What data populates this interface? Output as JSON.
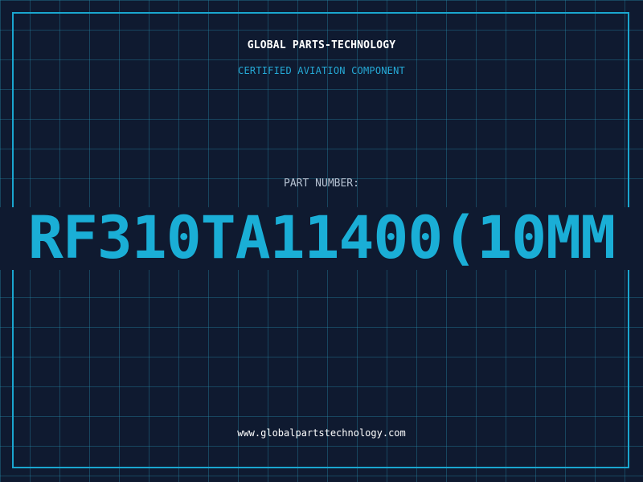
{
  "header": {
    "company": "GLOBAL PARTS-TECHNOLOGY",
    "subtitle": "CERTIFIED AVIATION COMPONENT"
  },
  "part": {
    "label": "PART NUMBER:",
    "number": "RF310TA11400(10MM"
  },
  "footer": {
    "website": "www.globalpartstechnology.com"
  },
  "colors": {
    "background": "#0f1a30",
    "grid": "#288caa",
    "accent": "#1aaed6",
    "primary_text": "#ffffff",
    "muted_text": "#b7c3d3"
  }
}
